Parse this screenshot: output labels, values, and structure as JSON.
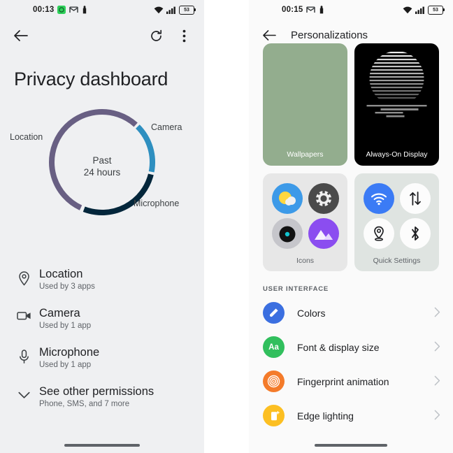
{
  "left_phone": {
    "status_bar": {
      "time": "00:13",
      "icons": [
        "badge-green-icon",
        "gmail-icon",
        "notification-icon"
      ],
      "right_icons": [
        "wifi-icon",
        "signal-icon"
      ],
      "battery_level": "53"
    },
    "app_bar": {
      "back_icon": "arrow-back-icon",
      "refresh_icon": "refresh-icon",
      "overflow_icon": "more-vertical-icon"
    },
    "page_title": "Privacy dashboard",
    "chart_data": {
      "type": "pie",
      "title": "Privacy dashboard",
      "center_line_1": "Past",
      "center_line_2": "24 hours",
      "legend_position": "around-arcs",
      "categories": [
        "Location",
        "Camera",
        "Microphone"
      ],
      "values": [
        55,
        16,
        27
      ],
      "colors": [
        "#685f83",
        "#2e8fc0",
        "#03263b"
      ],
      "labels": [
        "Location",
        "Camera",
        "Microphone"
      ],
      "segments": [
        {
          "name": "Location",
          "value": 55,
          "color": "#685f83",
          "start_deg": 205,
          "end_deg": 402
        },
        {
          "name": "Camera",
          "value": 16,
          "color": "#2e8fc0",
          "start_deg": 45,
          "end_deg": 101
        },
        {
          "name": "Microphone",
          "value": 27,
          "color": "#03263b",
          "start_deg": 104,
          "end_deg": 201
        }
      ]
    },
    "permissions": [
      {
        "icon": "location-pin-icon",
        "title": "Location",
        "subtitle": "Used by 3 apps"
      },
      {
        "icon": "camera-video-icon",
        "title": "Camera",
        "subtitle": "Used by 1 app"
      },
      {
        "icon": "microphone-icon",
        "title": "Microphone",
        "subtitle": "Used by 1 app"
      }
    ],
    "see_other": {
      "icon": "chevron-down-icon",
      "title": "See other permissions",
      "subtitle": "Phone, SMS, and 7 more"
    }
  },
  "right_phone": {
    "status_bar": {
      "time": "00:15",
      "icons": [
        "gmail-icon",
        "notification-icon"
      ],
      "right_icons": [
        "wifi-icon",
        "signal-icon"
      ],
      "battery_level": "53"
    },
    "app_bar": {
      "back_icon": "arrow-back-icon",
      "title": "Personalizations"
    },
    "top_cards": [
      {
        "name": "wallpapers",
        "caption": "Wallpapers",
        "color": "#93ad8e"
      },
      {
        "name": "always-on-display",
        "caption": "Always-On Display",
        "color": "#000000"
      }
    ],
    "icons_card": {
      "caption": "Icons",
      "icons": [
        "weather-icon",
        "settings-gear-icon",
        "camera-lens-icon",
        "gallery-icon"
      ]
    },
    "quick_settings_card": {
      "caption": "Quick Settings",
      "icons": [
        "wifi-tile-icon",
        "data-transfer-tile-icon",
        "location-tile-icon",
        "bluetooth-tile-icon"
      ],
      "active_tile_color": "#3b7bf5"
    },
    "section_header": "USER INTERFACE",
    "ui_rows": [
      {
        "icon": "paint-roller-icon",
        "label": "Colors",
        "color": "#3b6fe0",
        "chevron": "chevron-right-icon"
      },
      {
        "icon": "font-size-icon",
        "label": "Font & display size",
        "color": "#31bf5d",
        "badge_text": "Aa",
        "chevron": "chevron-right-icon"
      },
      {
        "icon": "fingerprint-icon",
        "label": "Fingerprint animation",
        "color": "#f47b2a",
        "chevron": "chevron-right-icon"
      },
      {
        "icon": "edge-lighting-icon",
        "label": "Edge lighting",
        "color": "#fcbf22",
        "chevron": "chevron-right-icon"
      }
    ]
  }
}
